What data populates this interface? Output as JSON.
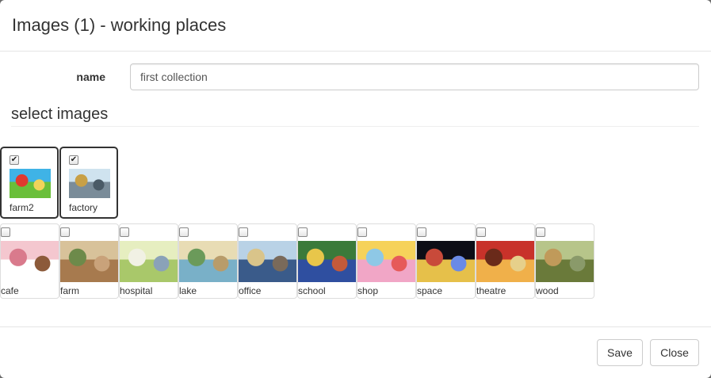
{
  "dialog": {
    "title": "Images (1) - working places"
  },
  "form": {
    "name_label": "name",
    "name_value": "first collection",
    "section_title": "select images"
  },
  "selected_images": [
    {
      "caption": "farm2",
      "checked": true,
      "palette": [
        "#3fb3e6",
        "#6abf3a",
        "#e03a2f",
        "#f2d35b"
      ]
    },
    {
      "caption": "factory",
      "checked": true,
      "palette": [
        "#cfe3ef",
        "#7a8c99",
        "#c8a046",
        "#4a5a66"
      ]
    }
  ],
  "available_images": [
    {
      "caption": "cafe",
      "checked": false,
      "palette": [
        "#f4c7cf",
        "#ffffff",
        "#d97a8c",
        "#8c5a3a"
      ]
    },
    {
      "caption": "farm",
      "checked": false,
      "palette": [
        "#d8c29a",
        "#a77a4e",
        "#6d8a4a",
        "#c9a27a"
      ]
    },
    {
      "caption": "hospital",
      "checked": false,
      "palette": [
        "#e6eec0",
        "#a9c86a",
        "#f1f1e4",
        "#8aa2b8"
      ]
    },
    {
      "caption": "lake",
      "checked": false,
      "palette": [
        "#e8dcb4",
        "#79b0c8",
        "#6b9a5a",
        "#b89c6a"
      ]
    },
    {
      "caption": "office",
      "checked": false,
      "palette": [
        "#b9d2e6",
        "#3a5b8a",
        "#d9c48a",
        "#7a6a5a"
      ]
    },
    {
      "caption": "school",
      "checked": false,
      "palette": [
        "#3b7a3a",
        "#2f4fa0",
        "#e8c64a",
        "#c45a3a"
      ]
    },
    {
      "caption": "shop",
      "checked": false,
      "palette": [
        "#f6d25a",
        "#f1a6c6",
        "#8ec8e6",
        "#e65a5a"
      ]
    },
    {
      "caption": "space",
      "checked": false,
      "palette": [
        "#0d0d16",
        "#e6c04a",
        "#c84a3a",
        "#6a8ae6"
      ]
    },
    {
      "caption": "theatre",
      "checked": false,
      "palette": [
        "#c8322a",
        "#f0b04a",
        "#6a2a1a",
        "#e6d08a"
      ]
    },
    {
      "caption": "wood",
      "checked": false,
      "palette": [
        "#b7c58a",
        "#6a7a3a",
        "#c09a5a",
        "#8a9a6a"
      ]
    }
  ],
  "footer": {
    "save_label": "Save",
    "close_label": "Close"
  }
}
